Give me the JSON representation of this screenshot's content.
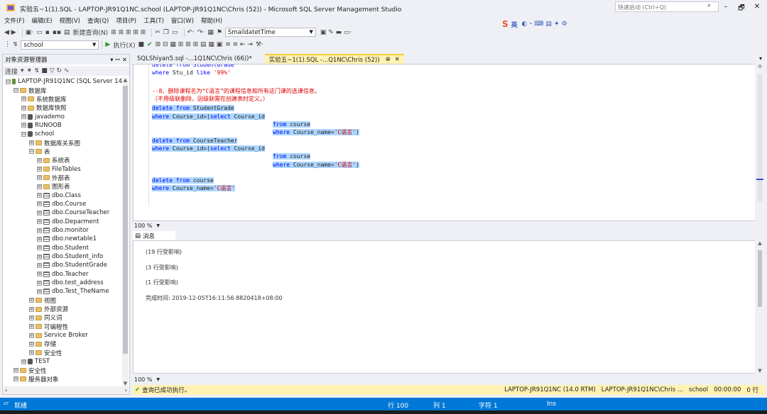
{
  "window": {
    "title": "实验五~1(1).SQL - LAPTOP-JR91Q1NC.school (LAPTOP-JR91Q1NC\\Chris (52)) - Microsoft SQL Server Management Studio",
    "quick_launch_placeholder": "快速启动 (Ctrl+Q)",
    "controls": [
      "–",
      "🗗",
      "✕"
    ]
  },
  "menu": [
    "文件(F)",
    "编辑(E)",
    "视图(V)",
    "查询(Q)",
    "项目(P)",
    "工具(T)",
    "窗口(W)",
    "帮助(H)"
  ],
  "toolbar1": {
    "new_query_label": "新建查询(N)",
    "datatype_combo": "SmalldatetTime"
  },
  "toolbar2": {
    "database_combo": "school",
    "execute_label": "执行(X)"
  },
  "ime": {
    "logo": "S",
    "label": "英"
  },
  "object_explorer": {
    "title": "对象资源管理器",
    "pin": "▾ ꟷ ✕",
    "connect_label": "连接",
    "tree": [
      {
        "level": 0,
        "expander": "⊟",
        "icon": "server",
        "label": "LAPTOP-JR91Q1NC (SQL Server 14"
      },
      {
        "level": 1,
        "expander": "⊟",
        "icon": "folder",
        "label": "数据库"
      },
      {
        "level": 2,
        "expander": "⊞",
        "icon": "folder",
        "label": "系统数据库"
      },
      {
        "level": 2,
        "expander": "⊞",
        "icon": "folder",
        "label": "数据库快照"
      },
      {
        "level": 2,
        "expander": "⊞",
        "icon": "db",
        "label": "javademo"
      },
      {
        "level": 2,
        "expander": "⊞",
        "icon": "db",
        "label": "RUNOOB"
      },
      {
        "level": 2,
        "expander": "⊟",
        "icon": "db",
        "label": "school"
      },
      {
        "level": 3,
        "expander": "⊞",
        "icon": "folder",
        "label": "数据库关系图"
      },
      {
        "level": 3,
        "expander": "⊟",
        "icon": "folder",
        "label": "表"
      },
      {
        "level": 4,
        "expander": "⊞",
        "icon": "folder",
        "label": "系统表"
      },
      {
        "level": 4,
        "expander": "⊞",
        "icon": "folder",
        "label": "FileTables"
      },
      {
        "level": 4,
        "expander": "⊞",
        "icon": "folder",
        "label": "外部表"
      },
      {
        "level": 4,
        "expander": "⊞",
        "icon": "folder",
        "label": "图形表"
      },
      {
        "level": 4,
        "expander": "⊞",
        "icon": "tbl",
        "label": "dbo.Class"
      },
      {
        "level": 4,
        "expander": "⊞",
        "icon": "tbl",
        "label": "dbo.Course"
      },
      {
        "level": 4,
        "expander": "⊞",
        "icon": "tbl",
        "label": "dbo.CourseTeacher"
      },
      {
        "level": 4,
        "expander": "⊞",
        "icon": "tbl",
        "label": "dbo.Deparment"
      },
      {
        "level": 4,
        "expander": "⊞",
        "icon": "tbl",
        "label": "dbo.monitor"
      },
      {
        "level": 4,
        "expander": "⊞",
        "icon": "tbl",
        "label": "dbo.newtable1"
      },
      {
        "level": 4,
        "expander": "⊞",
        "icon": "tbl",
        "label": "dbo.Student"
      },
      {
        "level": 4,
        "expander": "⊞",
        "icon": "tbl",
        "label": "dbo.Student_info"
      },
      {
        "level": 4,
        "expander": "⊞",
        "icon": "tbl",
        "label": "dbo.StudentGrade"
      },
      {
        "level": 4,
        "expander": "⊞",
        "icon": "tbl",
        "label": "dbo.Teacher"
      },
      {
        "level": 4,
        "expander": "⊞",
        "icon": "tbl",
        "label": "dbo.test_address"
      },
      {
        "level": 4,
        "expander": "⊞",
        "icon": "tbl",
        "label": "dbo.Test_TheName"
      },
      {
        "level": 3,
        "expander": "⊞",
        "icon": "folder",
        "label": "视图"
      },
      {
        "level": 3,
        "expander": "⊞",
        "icon": "folder",
        "label": "外部资源"
      },
      {
        "level": 3,
        "expander": "⊞",
        "icon": "folder",
        "label": "同义词"
      },
      {
        "level": 3,
        "expander": "⊞",
        "icon": "folder",
        "label": "可编程性"
      },
      {
        "level": 3,
        "expander": "⊞",
        "icon": "folder",
        "label": "Service Broker"
      },
      {
        "level": 3,
        "expander": "⊞",
        "icon": "folder",
        "label": "存储"
      },
      {
        "level": 3,
        "expander": "⊞",
        "icon": "folder",
        "label": "安全性"
      },
      {
        "level": 2,
        "expander": "⊞",
        "icon": "db",
        "label": "TEST"
      },
      {
        "level": 1,
        "expander": "⊞",
        "icon": "folder",
        "label": "安全性"
      },
      {
        "level": 1,
        "expander": "⊞",
        "icon": "folder",
        "label": "服务器对象"
      }
    ]
  },
  "tabs": [
    {
      "label": "SQLShiyan5.sql -...1Q1NC\\Chris (66))*"
    },
    {
      "label": "实验五~1(1).SQL -...Q1NC\\Chris (52))",
      "pin": "⊕",
      "close": "✕"
    }
  ],
  "editor": {
    "zoom": "100 %",
    "lines": [
      {
        "text": "delete from StudentGrade",
        "kind": "gray"
      },
      {
        "text": "where Stu_id like '99%'",
        "kind": "mixed1"
      },
      {
        "text": "--8、删除课程名为“C语言”的课程信息和所有这门课的选课信息。",
        "kind": "comment"
      },
      {
        "text": "（不用级联删除，因级联需在创建表时定义。）",
        "kind": "comment"
      },
      {
        "text": "delete from StudentGrade",
        "kind": "sel"
      },
      {
        "text": "where Course_id=(select Course_id",
        "kind": "sel"
      },
      {
        "text": "from course",
        "kind": "sel_indent"
      },
      {
        "text": "where Course_name='C语言')",
        "kind": "sel_indent"
      },
      {
        "text": "delete from CourseTeacher",
        "kind": "sel"
      },
      {
        "text": "where Course_id=(select Course_id",
        "kind": "sel"
      },
      {
        "text": "from course",
        "kind": "sel_indent"
      },
      {
        "text": "where Course_name='C语言')",
        "kind": "sel_indent"
      },
      {
        "text": "delete from course",
        "kind": "sel"
      },
      {
        "text": "where Course_name='C语言'",
        "kind": "sel"
      }
    ]
  },
  "messages": {
    "tab_label": "消息",
    "lines": [
      "(19 行受影响)",
      "(3 行受影响)",
      "(1 行受影响)",
      "完成时间: 2019-12-05T16:11:56.8820418+08:00"
    ],
    "zoom": "100 %"
  },
  "query_status": {
    "message": "查询已成功执行。",
    "server": "LAPTOP-JR91Q1NC (14.0 RTM)",
    "user": "LAPTOP-JR91Q1NC\\Chris ...",
    "database": "school",
    "elapsed": "00:00:00",
    "rows": "0 行"
  },
  "statusbar": {
    "ready": "就绪",
    "line": "行 100",
    "col": "列 1",
    "char": "字符 1",
    "mode": "Ins"
  },
  "colors": {
    "accent": "#0078d7",
    "tab_active": "#fff2b3",
    "selection": "#add6ff",
    "keyword": "#0000ff",
    "string": "#e00000",
    "comment": "#008000"
  }
}
